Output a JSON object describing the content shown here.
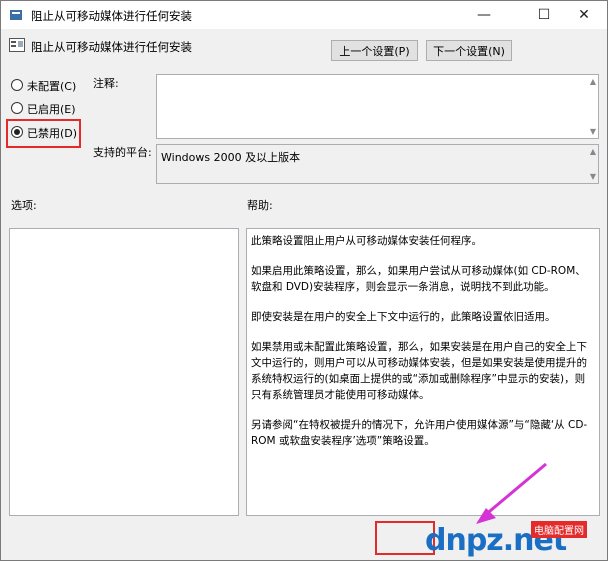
{
  "window": {
    "title": "阻止从可移动媒体进行任何安装",
    "minimize_glyph": "—",
    "maximize_glyph": "☐",
    "close_glyph": "✕"
  },
  "header": {
    "policy_title": "阻止从可移动媒体进行任何安装",
    "prev_button": "上一个设置(P)",
    "next_button": "下一个设置(N)"
  },
  "state": {
    "options": [
      {
        "label": "未配置(C)",
        "selected": false
      },
      {
        "label": "已启用(E)",
        "selected": false
      },
      {
        "label": "已禁用(D)",
        "selected": true
      }
    ]
  },
  "comment": {
    "label": "注释:",
    "value": ""
  },
  "platform": {
    "label": "支持的平台:",
    "value": "Windows 2000 及以上版本"
  },
  "options_section": {
    "label": "选项:"
  },
  "help_section": {
    "label": "帮助:",
    "paragraphs": [
      "此策略设置阻止用户从可移动媒体安装任何程序。",
      "如果启用此策略设置，那么，如果用户尝试从可移动媒体(如 CD-ROM、软盘和 DVD)安装程序，则会显示一条消息，说明找不到此功能。",
      "即使安装是在用户的安全上下文中运行的，此策略设置依旧适用。",
      "如果禁用或未配置此策略设置，那么，如果安装是在用户自己的安全上下文中运行的，则用户可以从可移动媒体安装，但是如果安装是使用提升的系统特权运行的(如桌面上提供的或“添加或删除程序”中显示的安装)，则只有系统管理员才能使用可移动媒体。",
      "另请参阅“在特权被提升的情况下，允许用户使用媒体源”与“隐藏‘从 CD-ROM 或软盘安装程序’选项”策略设置。"
    ]
  },
  "watermark": {
    "logo_text": "dnpz.net",
    "badge_text": "电脑配置网"
  },
  "colors": {
    "highlight": "#e32b2b",
    "logo_blue": "#1a6fc4",
    "arrow": "#d633d6"
  }
}
